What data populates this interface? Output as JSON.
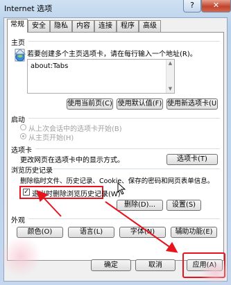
{
  "window": {
    "title": "Internet 选项",
    "help_label": "?",
    "close_label": "✕"
  },
  "tabs": [
    {
      "label": "常规",
      "active": true
    },
    {
      "label": "安全"
    },
    {
      "label": "隐私"
    },
    {
      "label": "内容"
    },
    {
      "label": "连接"
    },
    {
      "label": "程序"
    },
    {
      "label": "高级"
    }
  ],
  "homepage": {
    "section_label": "主页",
    "description": "若要创建多个主页选项卡，请在每行输入一个地址(R)。",
    "url": "about:Tabs",
    "use_current": "使用当前页(C)",
    "use_default": "使用默认值(F)",
    "use_new_tab": "使用新选项卡(U)"
  },
  "startup": {
    "section_label": "启动",
    "option_last_session": "从上次会话中的选项卡开始(B)",
    "option_homepage": "从主页开始(H)"
  },
  "tabsection": {
    "section_label": "选项卡",
    "description": "更改网页在选项卡中的显示方式。",
    "button": "选项卡(T)"
  },
  "history": {
    "section_label": "浏览历史记录",
    "description": "删除临时文件、历史记录、Cookie、保存的密码和网页表单信息。",
    "checkbox_label": "退出时删除浏览历史记录(W)",
    "delete_button": "删除(D)...",
    "settings_button": "设置(S)"
  },
  "appearance": {
    "section_label": "外观",
    "colors": "颜色(O)",
    "languages": "语言(L)",
    "fonts": "字体(N)",
    "accessibility": "辅助功能(E)"
  },
  "footer": {
    "ok": "确定",
    "cancel": "取消",
    "apply": "应用(A)"
  },
  "colors": {
    "highlight": "#e8141d",
    "title_bg": "#b9d1ea",
    "close_button": "#c0452d"
  }
}
